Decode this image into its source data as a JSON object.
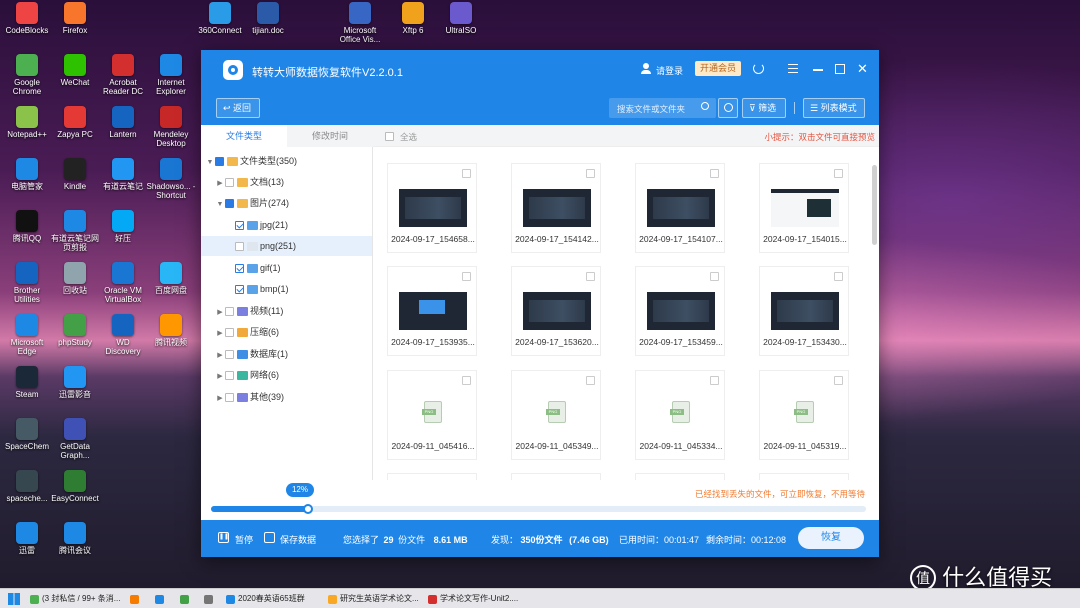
{
  "desktop": {
    "icons": [
      {
        "label": "CodeBlocks",
        "color": "#e44"
      },
      {
        "label": "Firefox",
        "color": "#f7762b"
      },
      {
        "label": "360Connect",
        "color": "#2a9be6"
      },
      {
        "label": "tijian.doc",
        "color": "#2b5aa8"
      },
      {
        "label": "Microsoft Office Vis...",
        "color": "#3866c4"
      },
      {
        "label": "Xftp 6",
        "color": "#f0a21c"
      },
      {
        "label": "UltraISO",
        "color": "#6a5acd"
      },
      {
        "label": "Google Chrome",
        "color": "#4caf50"
      },
      {
        "label": "WeChat",
        "color": "#2dc100"
      },
      {
        "label": "Acrobat Reader DC",
        "color": "#d32f2f"
      },
      {
        "label": "Internet Explorer",
        "color": "#1e88e5"
      },
      {
        "label": "Notepad++",
        "color": "#8bc34a"
      },
      {
        "label": "Zapya PC",
        "color": "#e53935"
      },
      {
        "label": "Lantern",
        "color": "#1565c0"
      },
      {
        "label": "Mendeley Desktop",
        "color": "#c62828"
      },
      {
        "label": "电脑管家",
        "color": "#1e88e5"
      },
      {
        "label": "Kindle",
        "color": "#222"
      },
      {
        "label": "有道云笔记",
        "color": "#2196f3"
      },
      {
        "label": "Shadowso... - Shortcut",
        "color": "#1976d2"
      },
      {
        "label": "腾讯QQ",
        "color": "#111"
      },
      {
        "label": "有道云笔记网页剪报",
        "color": "#1e88e5"
      },
      {
        "label": "好压",
        "color": "#03a9f4"
      },
      {
        "label": "Brother Utilities",
        "color": "#1565c0"
      },
      {
        "label": "回收站",
        "color": "#90a4ae"
      },
      {
        "label": "Oracle VM VirtualBox",
        "color": "#1976d2"
      },
      {
        "label": "百度网盘",
        "color": "#29b6f6"
      },
      {
        "label": "Microsoft Edge",
        "color": "#1e88e5"
      },
      {
        "label": "phpStudy",
        "color": "#43a047"
      },
      {
        "label": "WD Discovery",
        "color": "#1565c0"
      },
      {
        "label": "腾讯视频",
        "color": "#ff9800"
      },
      {
        "label": "Steam",
        "color": "#1b2838"
      },
      {
        "label": "迅雷影音",
        "color": "#2196f3"
      },
      {
        "label": "SpaceChem",
        "color": "#455a64"
      },
      {
        "label": "GetData Graph...",
        "color": "#3f51b5"
      },
      {
        "label": "spaceche...",
        "color": "#37474f"
      },
      {
        "label": "EasyConnect",
        "color": "#2e7d32"
      },
      {
        "label": "迅雷",
        "color": "#1e88e5"
      },
      {
        "label": "腾讯会议",
        "color": "#1e88e5"
      }
    ]
  },
  "app": {
    "title": "转转大师数据恢复软件V2.2.0.1",
    "login": "请登录",
    "vip": "开通会员",
    "back": "返回",
    "search_placeholder": "搜索文件或文件夹",
    "filter": "筛选",
    "list_mode": "列表模式",
    "tabs": [
      "文件类型",
      "修改时间"
    ],
    "select_all": "全选",
    "tip": "小提示：双击文件可直接预览",
    "tree": [
      {
        "label": "文件类型(350)",
        "color": "#f2b84b"
      },
      {
        "label": "文档(13)",
        "color": "#f2b84b"
      },
      {
        "label": "图片(274)",
        "color": "#f2b84b"
      },
      {
        "label": "jpg(21)",
        "color": "#5aa3e8"
      },
      {
        "label": "png(251)",
        "color": "#dfe6ee"
      },
      {
        "label": "gif(1)",
        "color": "#5aa3e8"
      },
      {
        "label": "bmp(1)",
        "color": "#5aa3e8"
      },
      {
        "label": "视频(11)",
        "color": "#7b7fe0"
      },
      {
        "label": "压缩(6)",
        "color": "#f2a93b"
      },
      {
        "label": "数据库(1)",
        "color": "#3e8ee6"
      },
      {
        "label": "网络(6)",
        "color": "#3bb7a0"
      },
      {
        "label": "其他(39)",
        "color": "#7b7fe0"
      }
    ],
    "files": [
      "2024-09-17_154658...",
      "2024-09-17_154142...",
      "2024-09-17_154107...",
      "2024-09-17_154015...",
      "2024-09-17_153935...",
      "2024-09-17_153620...",
      "2024-09-17_153459...",
      "2024-09-17_153430...",
      "2024-09-11_045416...",
      "2024-09-11_045349...",
      "2024-09-11_045334...",
      "2024-09-11_045319..."
    ],
    "png_badge": "PNG",
    "progress_pct": "12%",
    "progress_value": 0.12,
    "progress_msg": "已经找到丢失的文件，可立即恢复，不用等待",
    "pause": "暂停",
    "save": "保存数据",
    "selected": {
      "pre": "您选择了",
      "count": "29",
      "unit": "份文件",
      "size": "8.61 MB"
    },
    "found": {
      "pre": "发现：",
      "count": "350份文件",
      "size": "(7.46 GB)"
    },
    "elapsed": {
      "label": "已用时间：",
      "value": "00:01:47"
    },
    "remaining": {
      "label": "剩余时间：",
      "value": "00:12:08"
    },
    "recover": "恢复"
  },
  "taskbar": {
    "items": [
      {
        "label": "(3 封私信 / 99+ 条消...",
        "color": "#4caf50"
      },
      {
        "label": "",
        "color": "#f57c00"
      },
      {
        "label": "",
        "color": "#1e88e5"
      },
      {
        "label": "",
        "color": "#43a047"
      },
      {
        "label": "",
        "color": "#757575"
      },
      {
        "label": "2020春英语65班群",
        "color": "#1e88e5"
      },
      {
        "label": "研究生英语学术论文...",
        "color": "#f9a825"
      },
      {
        "label": "学术论文写作-Unit2....",
        "color": "#d32f2f"
      }
    ],
    "watermark": "值 什么值得买"
  }
}
